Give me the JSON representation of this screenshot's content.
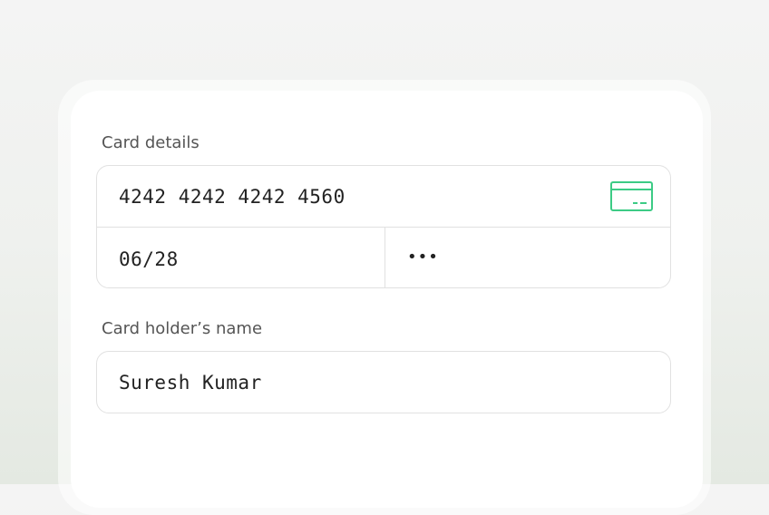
{
  "colors": {
    "accent": "#3ccb85",
    "border": "#e1e1e1",
    "label": "#555555",
    "text": "#222222"
  },
  "card_details": {
    "label": "Card details",
    "card_number": "4242 4242 4242 4560",
    "card_icon": "credit-card-icon",
    "expiry": "06/28",
    "cvc_masked": "•••"
  },
  "holder": {
    "label": "Card holder’s name",
    "name": "Suresh Kumar"
  }
}
